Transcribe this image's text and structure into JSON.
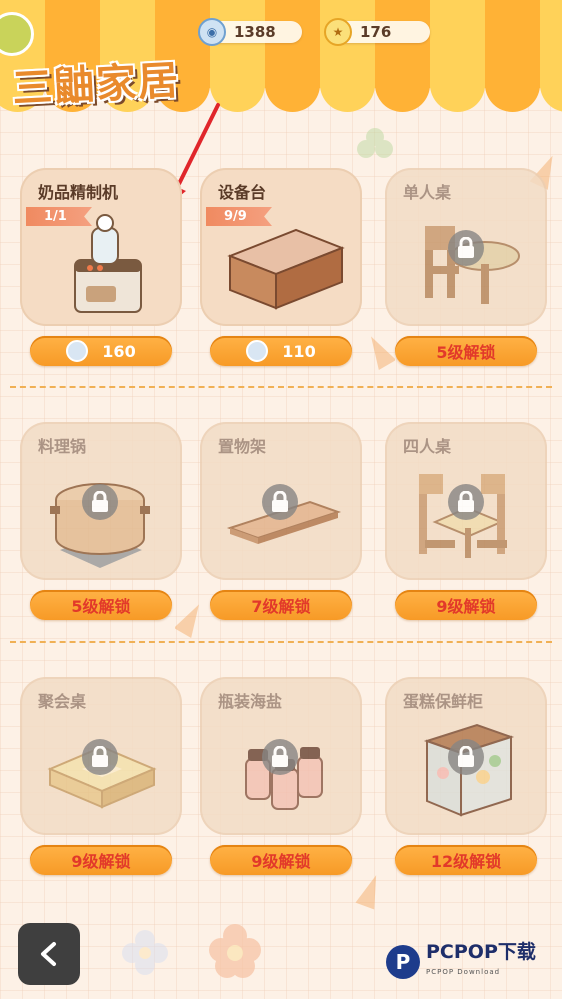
{
  "header": {
    "logo_text": "三鼬家居",
    "currency": [
      {
        "icon": "blue-coin-icon",
        "value": "1388"
      },
      {
        "icon": "gold-coin-icon",
        "value": "176"
      }
    ]
  },
  "rows": [
    [
      {
        "name": "奶品精制机",
        "badge": "1/1",
        "status": "purchasable",
        "button": "160",
        "button_icon": "blue-coin-icon",
        "illustration": "milk-machine-icon"
      },
      {
        "name": "设备台",
        "badge": "9/9",
        "status": "purchasable",
        "button": "110",
        "button_icon": "blue-coin-icon",
        "illustration": "counter-table-icon"
      },
      {
        "name": "单人桌",
        "status": "locked",
        "button": "5级解锁",
        "illustration": "single-table-icon"
      }
    ],
    [
      {
        "name": "料理锅",
        "status": "locked",
        "button": "5级解锁",
        "illustration": "cooking-pot-icon"
      },
      {
        "name": "置物架",
        "status": "locked",
        "button": "7级解锁",
        "illustration": "shelf-icon"
      },
      {
        "name": "四人桌",
        "status": "locked",
        "button": "9级解锁",
        "illustration": "four-seat-table-icon"
      }
    ],
    [
      {
        "name": "聚会桌",
        "status": "locked",
        "button": "9级解锁",
        "illustration": "party-table-icon"
      },
      {
        "name": "瓶装海盐",
        "status": "locked",
        "button": "9级解锁",
        "illustration": "sea-salt-bottles-icon"
      },
      {
        "name": "蛋糕保鲜柜",
        "status": "locked",
        "button": "12级解锁",
        "illustration": "cake-cabinet-icon"
      }
    ]
  ],
  "footer": {
    "back_icon": "chevron-left-icon",
    "watermark": {
      "logo": "P",
      "title": "PCPOP下载",
      "subtitle": "PCPOP Download"
    }
  },
  "colors": {
    "accent_orange": "#f79a26",
    "lock_text_red": "#e2392a",
    "arrow_red": "#e0262b",
    "badge_salmon": "#f08a60"
  }
}
